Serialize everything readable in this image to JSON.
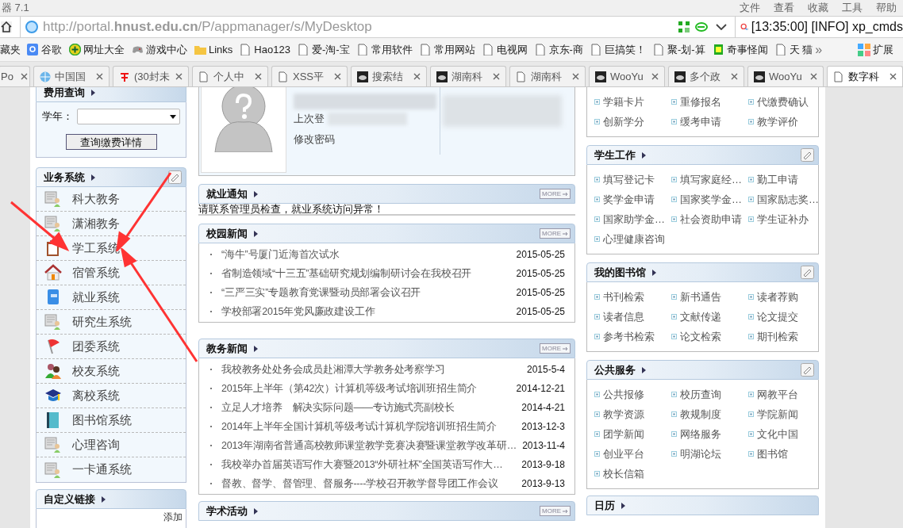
{
  "window": {
    "title": "器 7.1",
    "menu": [
      "文件",
      "查看",
      "收藏",
      "工具",
      "帮助"
    ]
  },
  "address_bar": {
    "url": "http://portal.**hnust.edu.cn**/P/appmanager/s/MyDesktop"
  },
  "search": {
    "value": "[13:35:00] [INFO] xp_cmds"
  },
  "bookmarks": [
    {
      "label": "藏夹",
      "kind": "none"
    },
    {
      "label": "谷歌",
      "kind": "google"
    },
    {
      "label": "网址大全",
      "kind": "plus"
    },
    {
      "label": "游戏中心",
      "kind": "gamepad"
    },
    {
      "label": "Links",
      "kind": "folder"
    },
    {
      "label": "Hao123",
      "kind": "page"
    },
    {
      "label": "爱-淘-宝",
      "kind": "page"
    },
    {
      "label": "常用软件",
      "kind": "page"
    },
    {
      "label": "常用网站",
      "kind": "page"
    },
    {
      "label": "电视网",
      "kind": "page"
    },
    {
      "label": "京东-商",
      "kind": "page"
    },
    {
      "label": "巨搞笑！",
      "kind": "page"
    },
    {
      "label": "聚-划-算",
      "kind": "page"
    },
    {
      "label": "奇事怪闻",
      "kind": "sou"
    },
    {
      "label": "天 猫",
      "kind": "page"
    }
  ],
  "bookmarks_more": "»",
  "extensions": "扩展",
  "tabs": [
    {
      "label": "Po",
      "kind": "none",
      "selected": false
    },
    {
      "label": "中国国",
      "kind": "globe",
      "selected": false
    },
    {
      "label": "(30封未",
      "kind": "mail",
      "selected": false
    },
    {
      "label": "个人中",
      "kind": "page",
      "selected": false
    },
    {
      "label": "XSS平",
      "kind": "page",
      "selected": false
    },
    {
      "label": "搜索结",
      "kind": "cloud",
      "selected": false
    },
    {
      "label": "湖南科",
      "kind": "cloud",
      "selected": false
    },
    {
      "label": "湖南科",
      "kind": "page",
      "selected": false
    },
    {
      "label": "WooYu",
      "kind": "cloud",
      "selected": false
    },
    {
      "label": "多个政",
      "kind": "cloud",
      "selected": false
    },
    {
      "label": "WooYu",
      "kind": "cloud",
      "selected": false
    },
    {
      "label": "数字科",
      "kind": "page",
      "selected": true
    }
  ],
  "fee_query": {
    "title": "费用查询",
    "year_label": "学年：",
    "button": "查询缴费详情"
  },
  "business_systems": {
    "title": "业务系统",
    "items": [
      {
        "label": "科大教务",
        "kind": "person"
      },
      {
        "label": "潇湘教务",
        "kind": "person"
      },
      {
        "label": "学工系统",
        "kind": "clipboard"
      },
      {
        "label": "宿管系统",
        "kind": "house"
      },
      {
        "label": "就业系统",
        "kind": "notebook"
      },
      {
        "label": "研究生系统",
        "kind": "person"
      },
      {
        "label": "团委系统",
        "kind": "flag"
      },
      {
        "label": "校友系统",
        "kind": "people"
      },
      {
        "label": "离校系统",
        "kind": "cap"
      },
      {
        "label": "图书馆系统",
        "kind": "book"
      },
      {
        "label": "心理咨询",
        "kind": "person"
      },
      {
        "label": "一卡通系统",
        "kind": "person"
      }
    ]
  },
  "custom_links": {
    "title": "自定义链接",
    "add": "添加"
  },
  "profile": {
    "last_login": "上次登",
    "change_password": "修改密码"
  },
  "employment_notice": {
    "title": "就业通知",
    "more": "MORE",
    "message": "请联系管理员检查，就业系统访问异常！"
  },
  "campus_news": {
    "title": "校园新闻",
    "more": "MORE",
    "rows": [
      {
        "title": "“海牛”号厦门近海首次试水",
        "date": "2015-05-25"
      },
      {
        "title": "省制造领域“十三五”基础研究规划编制研讨会在我校召开",
        "date": "2015-05-25"
      },
      {
        "title": "“三严三实”专题教育党课暨动员部署会议召开",
        "date": "2015-05-25"
      },
      {
        "title": "学校部署2015年党风廉政建设工作",
        "date": "2015-05-25"
      }
    ]
  },
  "academic_news": {
    "title": "教务新闻",
    "more": "MORE",
    "rows": [
      {
        "title": "我校教务处处务会成员赴湘潭大学教务处考察学习",
        "date": "2015-5-4"
      },
      {
        "title": "2015年上半年（第42次）计算机等级考试培训班招生简介",
        "date": "2014-12-21"
      },
      {
        "title": "立足人才培养　解决实际问题——专访施式亮副校长",
        "date": "2014-4-21"
      },
      {
        "title": "2014年上半年全国计算机等级考试计算机学院培训班招生简介",
        "date": "2013-12-3"
      },
      {
        "title": "2013年湖南省普通高校教师课堂教学竞赛决赛暨课堂教学改革研…",
        "date": "2013-11-4"
      },
      {
        "title": "我校举办首届英语写作大赛暨2013“外研社杯”全国英语写作大…",
        "date": "2013-9-18"
      },
      {
        "title": "督教、督学、督管理、督服务----学校召开教学督导团工作会议",
        "date": "2013-9-13"
      }
    ]
  },
  "academic_activities": {
    "title": "学术活动",
    "more": "MORE"
  },
  "student_records": {
    "items": [
      "学籍卡片",
      "重修报名",
      "代缴费确认",
      "创新学分",
      "缓考申请",
      "教学评价"
    ]
  },
  "student_work": {
    "title": "学生工作",
    "items": [
      "填写登记卡",
      "填写家庭经…",
      "勤工申请",
      "奖学金申请",
      "国家奖学金…",
      "国家励志奖…",
      "国家助学金…",
      "社会资助申请",
      "学生证补办",
      "心理健康咨询"
    ]
  },
  "my_library": {
    "title": "我的图书馆",
    "items": [
      "书刊检索",
      "新书通告",
      "读者荐购",
      "读者信息",
      "文献传递",
      "论文提交",
      "参考书检索",
      "论文检索",
      "期刊检索"
    ]
  },
  "public_services": {
    "title": "公共服务",
    "items": [
      "公共报修",
      "校历查询",
      "网教平台",
      "教学资源",
      "教规制度",
      "学院新闻",
      "团学新闻",
      "网络服务",
      "文化中国",
      "创业平台",
      "明湖论坛",
      "图书馆",
      "校长信箱"
    ]
  },
  "calendar": {
    "title": "日历"
  }
}
